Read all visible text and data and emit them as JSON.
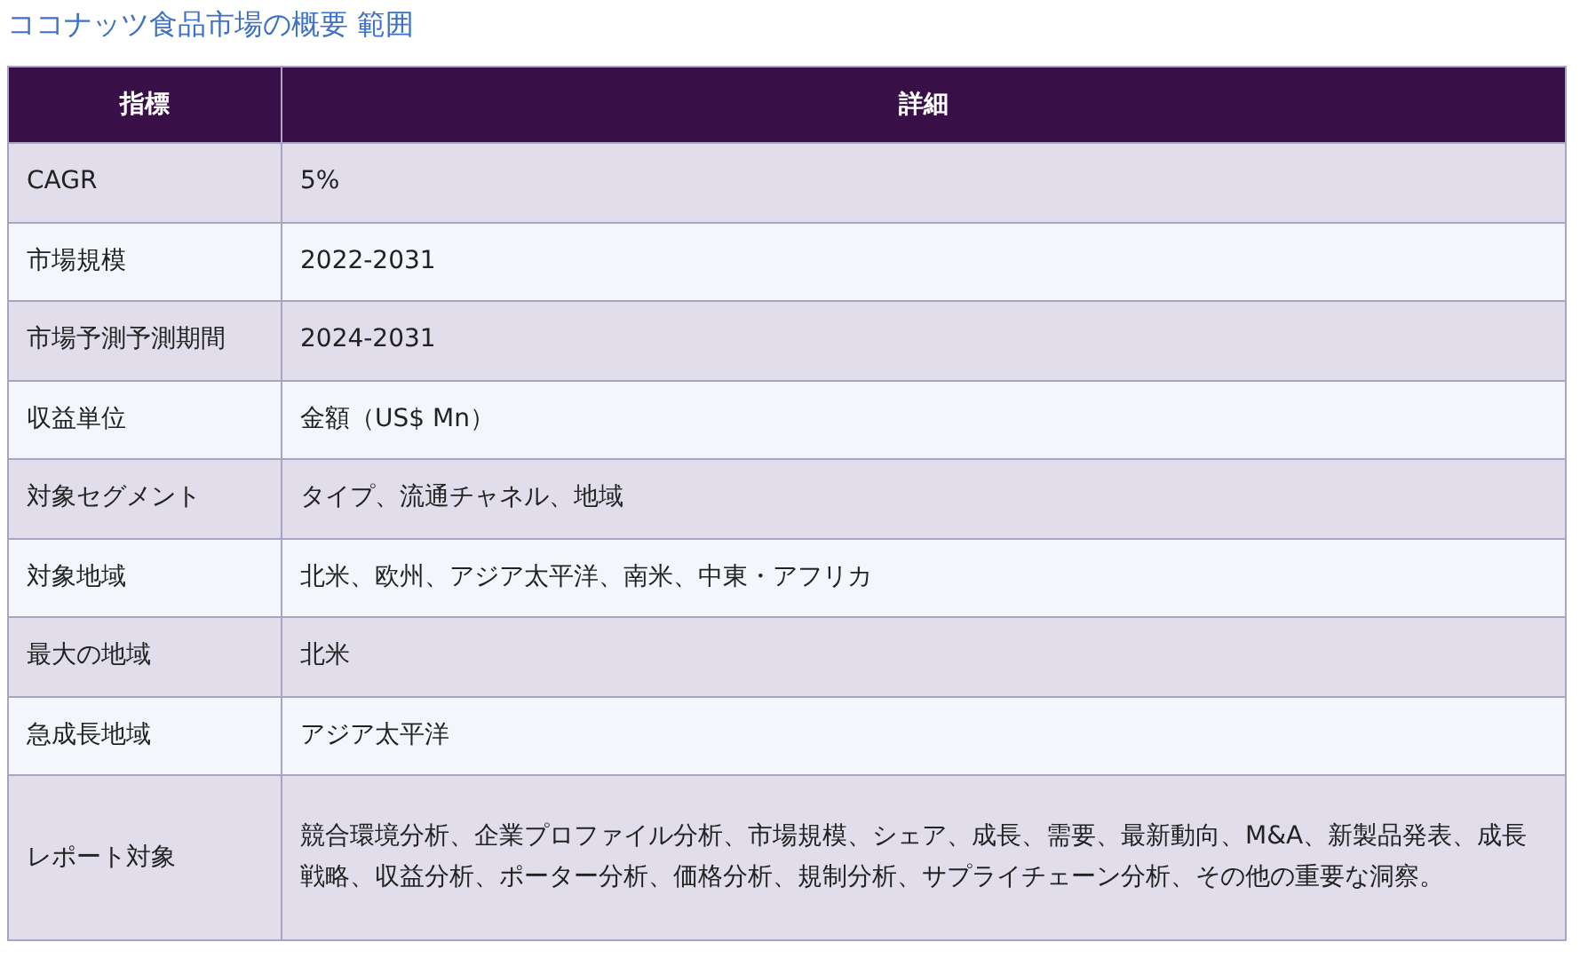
{
  "title": "ココナッツ食品市場の概要 範囲",
  "table": {
    "columns": [
      "指標",
      "詳細"
    ],
    "rows": [
      [
        "CAGR",
        "5%"
      ],
      [
        "市場規模",
        "2022-2031"
      ],
      [
        "市場予測予測期間",
        "2024-2031"
      ],
      [
        "収益単位",
        "金額（US$ Mn）"
      ],
      [
        "対象セグメント",
        "タイプ、流通チャネル、地域"
      ],
      [
        "対象地域",
        "北米、欧州、アジア太平洋、南米、中東・アフリカ"
      ],
      [
        "最大の地域",
        "北米"
      ],
      [
        "急成長地域",
        "アジア太平洋"
      ],
      [
        "レポート対象",
        "競合環境分析、企業プロファイル分析、市場規模、シェア、成長、需要、最新動向、M&A、新製品発表、成長戦略、収益分析、ポーター分析、価格分析、規制分析、サプライチェーン分析、その他の重要な洞察。"
      ]
    ]
  }
}
